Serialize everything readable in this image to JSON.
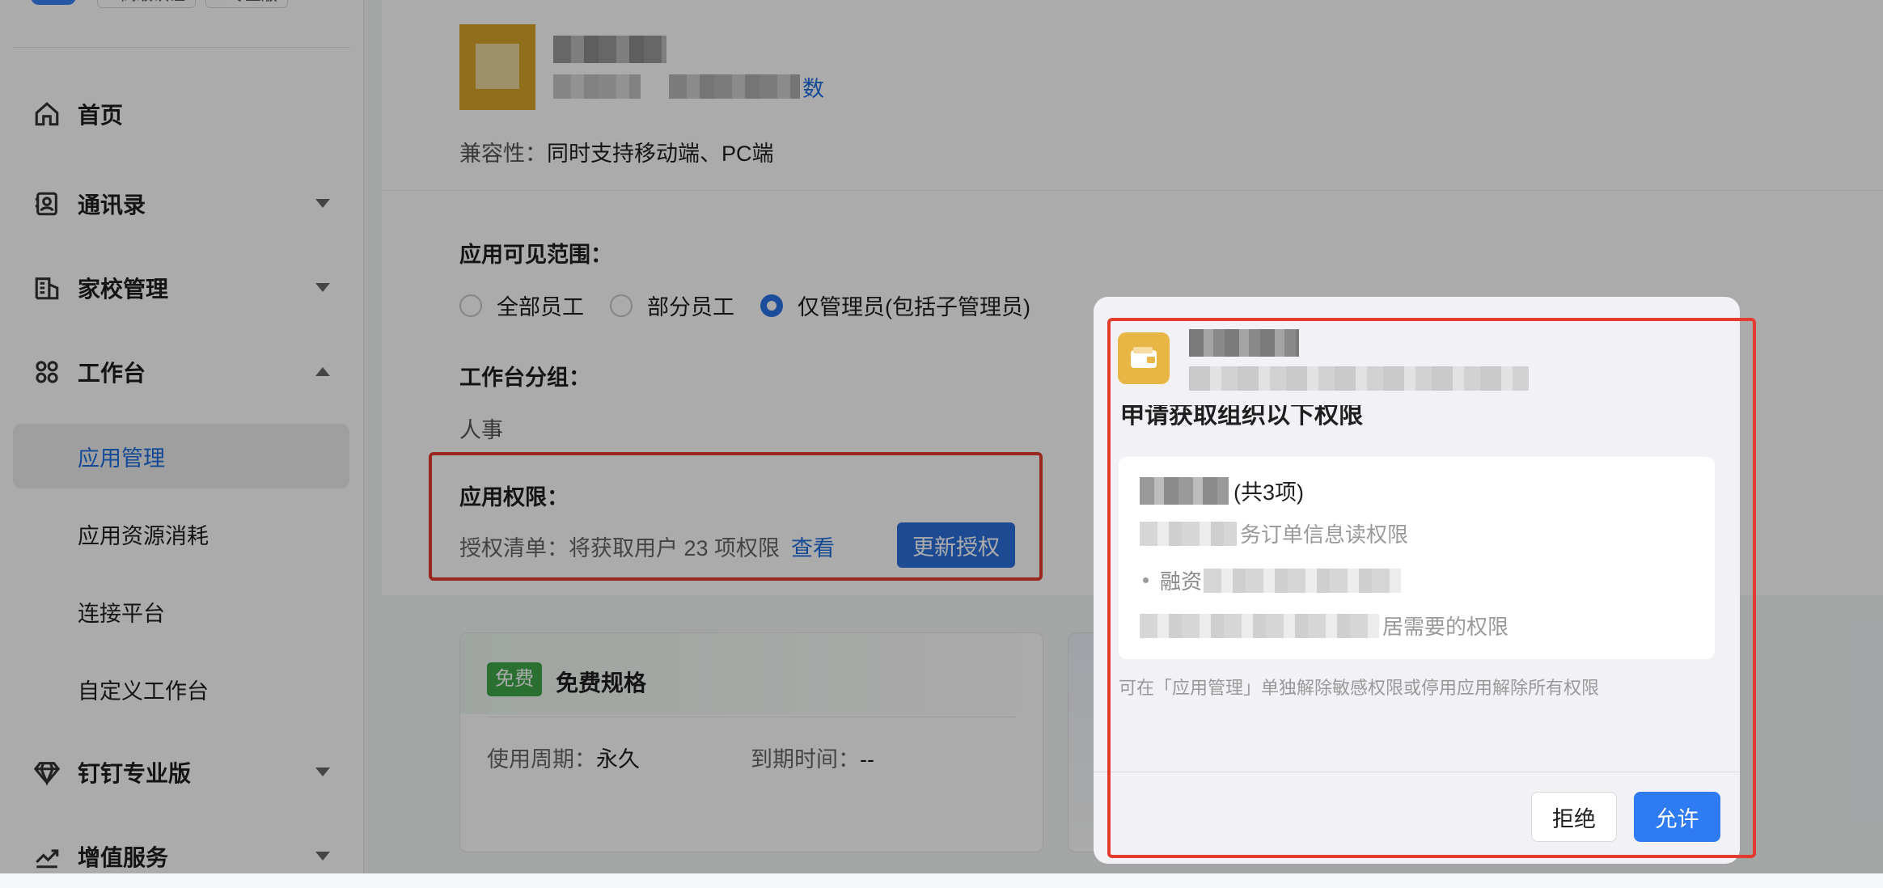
{
  "sidebar": {
    "badges": [
      "高级认证",
      "专业版"
    ],
    "nav": [
      {
        "label": "首页",
        "icon": "home-icon"
      },
      {
        "label": "通讯录",
        "icon": "contacts-icon"
      },
      {
        "label": "家校管理",
        "icon": "school-icon"
      },
      {
        "label": "工作台",
        "icon": "apps-grid-icon"
      }
    ],
    "sub": [
      "应用管理",
      "应用资源消耗",
      "连接平台",
      "自定义工作台"
    ],
    "nav_bottom": [
      {
        "label": "钉钉专业版",
        "icon": "diamond-icon"
      },
      {
        "label": "增值服务",
        "icon": "trend-icon"
      }
    ]
  },
  "main": {
    "link_tail": "数",
    "compat_label": "兼容性：",
    "compat_value": "同时支持移动端、PC端",
    "visibility_title": "应用可见范围：",
    "visibility_options": [
      "全部员工",
      "部分员工",
      "仅管理员(包括子管理员)"
    ],
    "visibility_selected": 2,
    "group_title": "工作台分组：",
    "group_value": "人事",
    "perm_title": "应用权限：",
    "perm_text": "授权清单：将获取用户 23 项权限",
    "perm_link": "查看",
    "update_button": "更新授权",
    "free_card": {
      "tag": "免费",
      "title": "免费规格",
      "period_label": "使用周期：",
      "period_value": "永久",
      "expire_label": "到期时间：",
      "expire_value": "--"
    }
  },
  "dialog": {
    "heading": "申请获取组织以下权限",
    "count_text": "(共3项)",
    "row1_tail": "务订单信息读权限",
    "row2_head": "融资",
    "row3_tail": "居需要的权限",
    "note": "可在「应用管理」单独解除敏感权限或停用应用解除所有权限",
    "reject": "拒绝",
    "allow": "允许"
  },
  "colors": {
    "accent": "#2f7bf3",
    "highlight_box": "#e33b2e",
    "free_tag": "#3fa84a"
  }
}
